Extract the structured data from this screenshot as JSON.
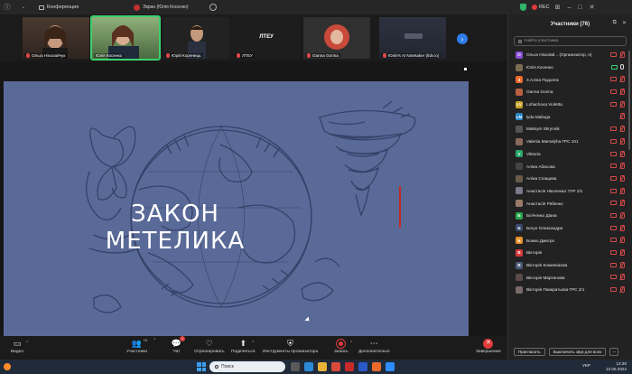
{
  "titlebar": {
    "tab_label": "Конференция",
    "share_label": "Экран (Юлія Косенко)"
  },
  "topbar": {
    "rec_label": "REC"
  },
  "thumbnails": [
    {
      "name": "Ольга Ніколайчук",
      "bg": "#3d2e28"
    },
    {
      "name": "Юлія Косенко",
      "bg": "#5f7a52"
    },
    {
      "name": "Юрій Коренець",
      "bg": "#2a2a2a"
    },
    {
      "name": "ЛТЕУ",
      "bg": "#1f1f1f",
      "text": "ЛТЕУ"
    },
    {
      "name": "Ganna Gorina",
      "bg": "#3a3a3a"
    },
    {
      "name": "Юлія's AI Notetaker (tldv.io)",
      "bg": "#2b2f3a"
    }
  ],
  "slide": {
    "title_line1": "ЗАКОН",
    "title_line2": "МЕТЕЛИКА"
  },
  "toolbar": {
    "video": "Видео",
    "participants": "Участники",
    "participants_count": "76",
    "chat": "Чат",
    "chat_badge": "1",
    "react": "Отреагировать",
    "share": "Поделиться",
    "host_tools": "Инструменты организатора",
    "record": "Запись",
    "more": "Дополнительно",
    "end": "Завершение"
  },
  "panel": {
    "title": "Участники (76)",
    "search_placeholder": "Найти участника",
    "invite": "Пригласить",
    "mute_all": "Выключить звук для всех",
    "more": "..."
  },
  "participants": [
    {
      "initials": "О",
      "name": "Ольга Ніколай... (Организатор, я)",
      "color": "#8a4fd6",
      "mic": "off",
      "cam": "off"
    },
    {
      "initials": "",
      "name": "Юлія Косенко",
      "color": "#7a6a50",
      "mic": "on",
      "cam": "on"
    },
    {
      "initials": "З",
      "name": "3.Аліна Подоляк",
      "color": "#e86b2a",
      "mic": "off",
      "cam": "off"
    },
    {
      "initials": "",
      "name": "Ganna Gorina",
      "color": "#b86040",
      "mic": "off",
      "cam": "off"
    },
    {
      "initials": "LV",
      "name": "Lohachova Violetta",
      "color": "#c9a22a",
      "mic": "off",
      "cam": "off"
    },
    {
      "initials": "LM",
      "name": "lyda Maliuga",
      "color": "#2a88c9",
      "mic": "off",
      "cam": ""
    },
    {
      "initials": "",
      "name": "Maksym Skrynnik",
      "color": "#555555",
      "mic": "off",
      "cam": "off"
    },
    {
      "initials": "",
      "name": "Valeriia Mamalyha ГРС 101",
      "color": "#8a6a5a",
      "mic": "off",
      "cam": "off"
    },
    {
      "initials": "V",
      "name": "Viktoria",
      "color": "#2aa66a",
      "mic": "off",
      "cam": "off"
    },
    {
      "initials": "",
      "name": "Аліна Абасова",
      "color": "#444444",
      "mic": "off",
      "cam": "off"
    },
    {
      "initials": "",
      "name": "Аліна Спащева",
      "color": "#6a5a4a",
      "mic": "off",
      "cam": "off"
    },
    {
      "initials": "",
      "name": "Анастасія Ніколенко ТУР 2/1",
      "color": "#7a7a8a",
      "mic": "off",
      "cam": "off"
    },
    {
      "initials": "",
      "name": "Анастасія Рябенко",
      "color": "#9a7a6a",
      "mic": "off",
      "cam": "off"
    },
    {
      "initials": "Б",
      "name": "Біліченко Діана",
      "color": "#2aa64a",
      "mic": "off",
      "cam": "off"
    },
    {
      "initials": "Б",
      "name": "Богун Олександра",
      "color": "#3a4a6a",
      "mic": "off",
      "cam": "off"
    },
    {
      "initials": "Б",
      "name": "Божко Дмитро",
      "color": "#e8922a",
      "mic": "off",
      "cam": "off"
    },
    {
      "initials": "В",
      "name": "Вікторія",
      "color": "#d83a3a",
      "mic": "off",
      "cam": "off"
    },
    {
      "initials": "В",
      "name": "Вікторія Кожевнікова",
      "color": "#4a5a7a",
      "mic": "off",
      "cam": "off"
    },
    {
      "initials": "",
      "name": "Вікторія Мартинова",
      "color": "#5a4a4a",
      "mic": "off",
      "cam": "off"
    },
    {
      "initials": "",
      "name": "Вікторія Панкратьєва ГРС 2/1",
      "color": "#7a6a6a",
      "mic": "off",
      "cam": "off"
    }
  ],
  "taskbar": {
    "search": "Поиск",
    "lang": "УКР",
    "time": "13:30",
    "date": "13.05.2024"
  }
}
